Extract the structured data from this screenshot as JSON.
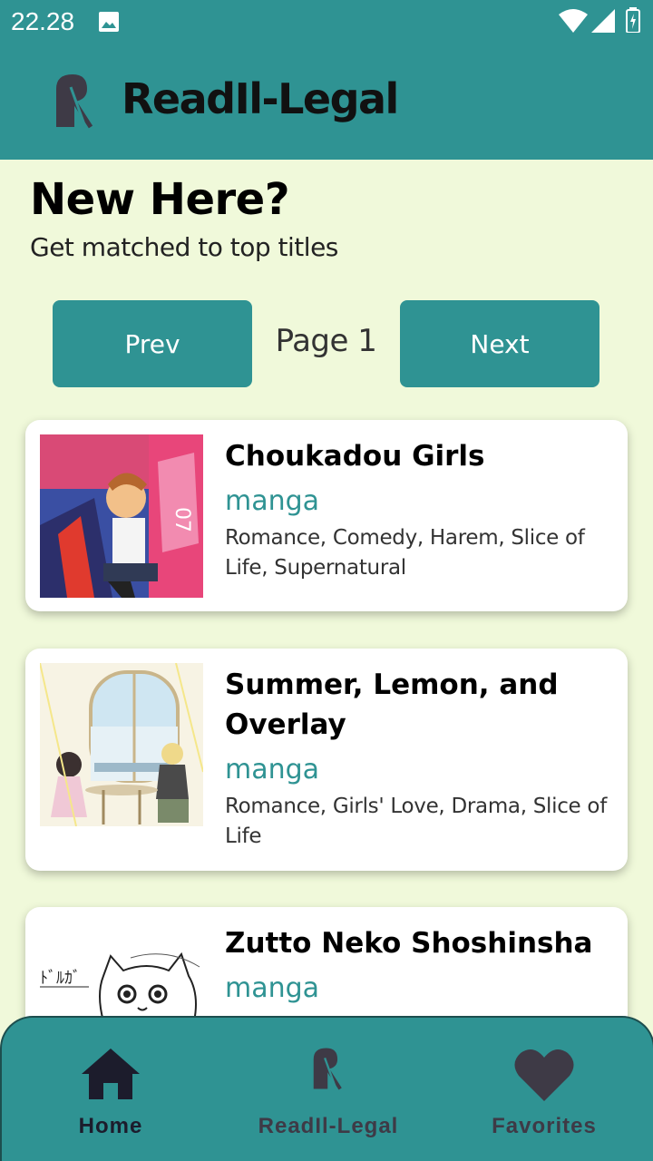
{
  "status_bar": {
    "time": "22.28"
  },
  "app_bar": {
    "title": "ReadIl-Legal"
  },
  "intro": {
    "heading": "New Here?",
    "subheading": "Get matched to top titles"
  },
  "pager": {
    "prev_label": "Prev",
    "page_label": "Page 1",
    "next_label": "Next"
  },
  "titles": [
    {
      "title": "Choukadou Girls",
      "type": "manga",
      "genres": "Romance, Comedy, Harem, Slice of Life, Supernatural"
    },
    {
      "title": "Summer, Lemon, and Overlay",
      "type": "manga",
      "genres": "Romance, Girls' Love, Drama, Slice of Life"
    },
    {
      "title": "Zutto Neko Shoshinsha",
      "type": "manga",
      "genres": ""
    }
  ],
  "bottom_nav": {
    "items": [
      {
        "label": "Home",
        "active": true
      },
      {
        "label": "ReadIl-Legal",
        "active": false
      },
      {
        "label": "Favorites",
        "active": false
      }
    ]
  },
  "colors": {
    "primary": "#2f9393",
    "background": "#f0f9da",
    "nav_active": "#1c1c2c",
    "nav_inactive": "#3e3a46"
  }
}
